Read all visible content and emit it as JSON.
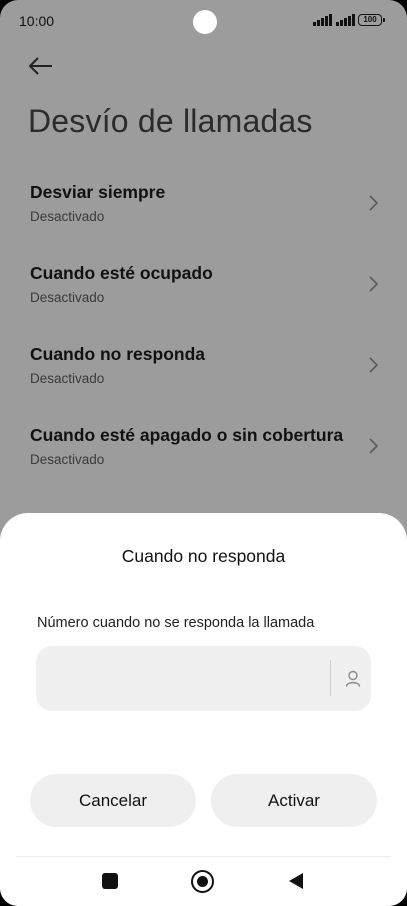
{
  "status_bar": {
    "time": "10:00",
    "battery": "100",
    "icons": [
      "signal-icon",
      "signal-icon",
      "battery-icon"
    ]
  },
  "header": {
    "back_icon": "arrow-left-icon",
    "title": "Desvío de llamadas"
  },
  "settings": {
    "items": [
      {
        "title": "Desviar siempre",
        "subtitle": "Desactivado"
      },
      {
        "title": "Cuando esté ocupado",
        "subtitle": "Desactivado"
      },
      {
        "title": "Cuando no responda",
        "subtitle": "Desactivado"
      },
      {
        "title": "Cuando esté apagado o sin cobertura",
        "subtitle": "Desactivado"
      }
    ],
    "chevron_icon": "chevron-right-icon"
  },
  "dialog": {
    "title": "Cuando no responda",
    "field_label": "Número cuando no se responda la llamada",
    "field_value": "",
    "contact_icon": "contact-person-icon",
    "cancel_label": "Cancelar",
    "activate_label": "Activar"
  },
  "nav_bar": {
    "icons": [
      "recents-square-icon",
      "home-circle-icon",
      "back-triangle-icon"
    ]
  },
  "colors": {
    "scrim_background": "#9c9c9c",
    "sheet_background": "#ffffff",
    "button_background": "#efefef",
    "input_background": "#f0f0f0"
  }
}
